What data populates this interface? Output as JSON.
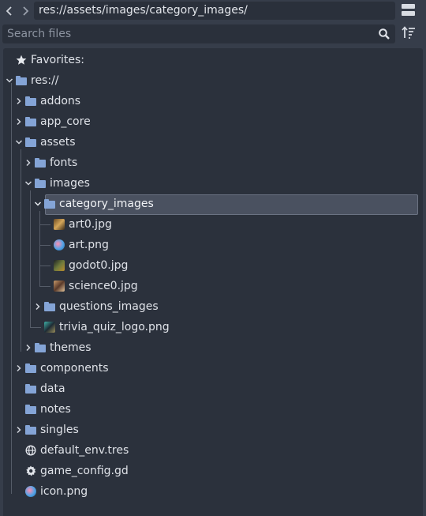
{
  "toolbar": {
    "back_icon": "chevron-left-icon",
    "forward_icon": "chevron-right-icon",
    "path": "res://assets/images/category_images/",
    "split_icon": "split-mode-icon"
  },
  "search": {
    "placeholder": "Search files",
    "value": "",
    "search_icon": "magnifier-icon",
    "sort_icon": "sort-icon"
  },
  "tree": {
    "favorites_label": "Favorites:",
    "root_label": "res://",
    "items": [
      {
        "label": "addons"
      },
      {
        "label": "app_core"
      },
      {
        "label": "assets"
      },
      {
        "label": "fonts"
      },
      {
        "label": "images"
      },
      {
        "label": "category_images"
      },
      {
        "label": "art0.jpg"
      },
      {
        "label": "art.png"
      },
      {
        "label": "godot0.jpg"
      },
      {
        "label": "science0.jpg"
      },
      {
        "label": "questions_images"
      },
      {
        "label": "trivia_quiz_logo.png"
      },
      {
        "label": "themes"
      },
      {
        "label": "components"
      },
      {
        "label": "data"
      },
      {
        "label": "notes"
      },
      {
        "label": "singles"
      },
      {
        "label": "default_env.tres"
      },
      {
        "label": "game_config.gd"
      },
      {
        "label": "icon.png"
      }
    ]
  },
  "colors": {
    "folder": "#84a4d6",
    "panel": "#2b313c",
    "background": "#363d4a",
    "selection": "#4a5160"
  }
}
